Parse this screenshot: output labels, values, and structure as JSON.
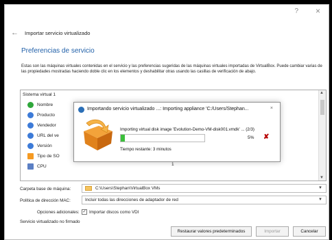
{
  "window": {
    "help": "?",
    "close": "×",
    "back": "←",
    "title": "Importar servicio virtualizado"
  },
  "section": {
    "title": "Preferencias de servicio",
    "description": "Estas son las máquinas virtuales contenidas en el servicio y las preferencias sugeridas de las máquinas virtuales importadas de VirtualBox. Puede cambiar varias de las propiedades mostradas haciendo doble clic en los elementos y deshabilitar otras usando las casillas de verificación de abajo."
  },
  "list": {
    "header": "Sistema virtual 1",
    "rows": [
      {
        "label": "Nombre",
        "value": "",
        "icon": "vm-icon",
        "color": "#2fa73b"
      },
      {
        "label": "Producto",
        "value": "",
        "icon": "info-icon",
        "color": "#3d7bd8"
      },
      {
        "label": "Vendedor",
        "value": "",
        "icon": "info-icon",
        "color": "#3d7bd8"
      },
      {
        "label": "URL del ve",
        "value": "",
        "icon": "info-icon",
        "color": "#3d7bd8"
      },
      {
        "label": "Versión",
        "value": "",
        "icon": "info-icon",
        "color": "#3d7bd8"
      },
      {
        "label": "Tipo de SO",
        "value": "",
        "icon": "os-icon",
        "color": "#f59a22"
      },
      {
        "label": "CPU",
        "value": "1",
        "icon": "cpu-icon",
        "color": "#5b7fc4"
      }
    ]
  },
  "form": {
    "folder_label": "Carpeta base de máquina:",
    "folder_value": "C:\\Users\\Stephan\\VirtualBox VMs",
    "mac_label": "Política de dirección MAC:",
    "mac_value": "Incluir todas las direcciones de adaptador de red",
    "extra_label": "Opciones adicionales:",
    "extra_checkbox": "Importar discos como VDI",
    "extra_checked": "✓",
    "signature": "Servicio virtualizado no firmado"
  },
  "buttons": {
    "restore": "Restaurar valores predeterminados",
    "import": "Importar",
    "cancel": "Cancelar"
  },
  "progress": {
    "title": "Importando servicio virtualizado ...: Importing appliance 'C:/Users/Stephan...",
    "close": "×",
    "operation": "Importing virtual disk image 'Evolution-Demo-VM-disk001.vmdk' ... (2/3)",
    "percent_text": "5%",
    "percent_value": 0.05,
    "cancel_icon": "✘",
    "remaining": "Tiempo restante: 3 minutos",
    "bar_color": "#3bbf3b"
  }
}
